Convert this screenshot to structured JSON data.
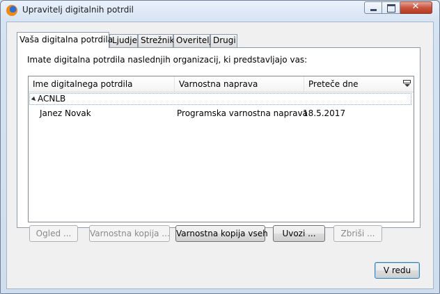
{
  "window": {
    "title": "Upravitelj digitalnih potrdil",
    "controls": {
      "minimize": "minimize-icon",
      "maximize": "maximize-icon",
      "close": "✕"
    }
  },
  "tabs": [
    {
      "label": "Vaša digitalna potrdila",
      "active": true
    },
    {
      "label": "Ljudje",
      "active": false
    },
    {
      "label": "Strežniki",
      "active": false
    },
    {
      "label": "Overitelji",
      "active": false
    },
    {
      "label": "Drugi",
      "active": false
    }
  ],
  "panel": {
    "intro": "Imate digitalna potrdila naslednjih organizacij, ki predstavljajo vas:",
    "columns": [
      "Ime digitalnega potrdila",
      "Varnostna naprava",
      "Preteče dne"
    ],
    "groups": [
      {
        "name": "ACNLB",
        "expanded": true,
        "rows": [
          {
            "name": "Janez Novak",
            "device": "Programska varnostna naprava",
            "expires": "18.5.2017"
          }
        ]
      }
    ]
  },
  "buttons": {
    "view": "Ogled ...",
    "backup": "Varnostna kopija ...",
    "backup_all": "Varnostna kopija vseh",
    "import": "Uvozi ...",
    "delete": "Zbriši ...",
    "ok": "V redu"
  }
}
